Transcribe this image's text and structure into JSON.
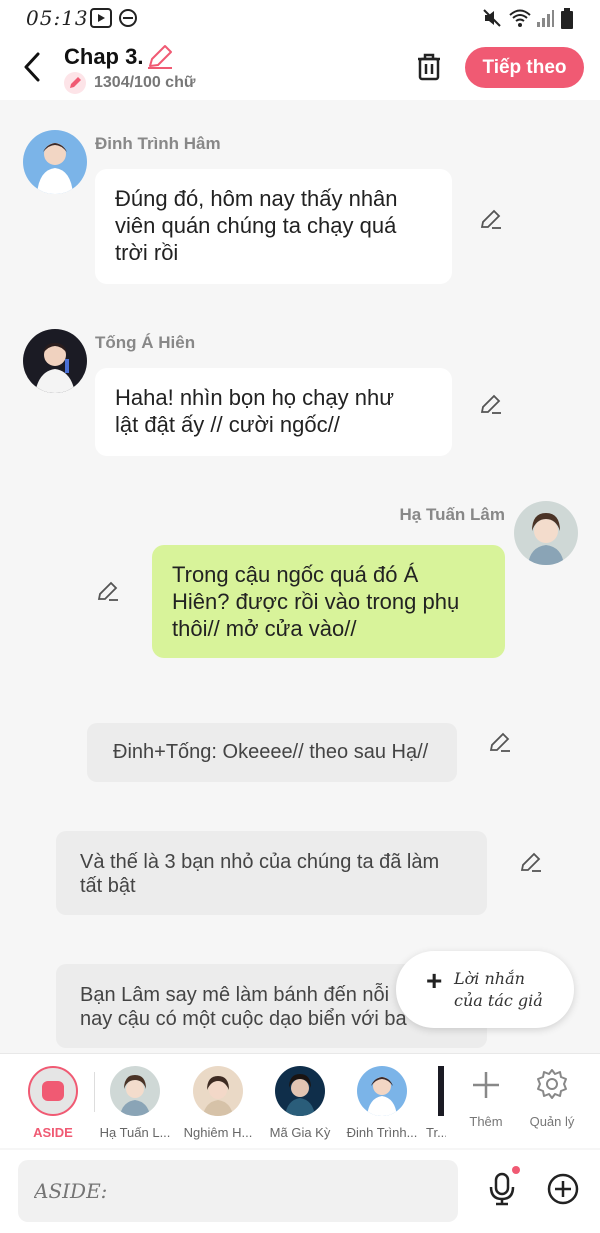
{
  "status_bar": {
    "time": "05:13"
  },
  "header": {
    "title": "Chap 3.",
    "word_count": "1304/100 chữ",
    "next_button": "Tiếp theo"
  },
  "messages": [
    {
      "speaker": "Đinh Trình Hâm",
      "text_lines": [
        "Đúng đó, hôm nay thấy nhân",
        "viên quán chúng ta chạy quá",
        "trời rồi"
      ]
    },
    {
      "speaker": "Tống Á Hiên",
      "text_lines": [
        "Haha! nhìn bọn họ chạy như",
        "lật đật ấy // cười ngốc//"
      ]
    },
    {
      "speaker": "Hạ Tuấn Lâm",
      "text_lines": [
        "Trong cậu ngốc quá đó Á",
        "Hiên? được rồi vào trong phụ",
        "thôi// mở cửa vào//"
      ]
    }
  ],
  "asides": [
    {
      "text": "Đinh+Tống: Okeeee// theo sau Hạ//"
    },
    {
      "text_lines": [
        "Và thế là 3 bạn nhỏ của chúng ta đã làm",
        "tất bật"
      ]
    },
    {
      "text_lines": [
        "Bạn Lâm say mê làm bánh đến nỗi",
        "nay cậu có một cuộc dạo biển với ba"
      ]
    }
  ],
  "author_note_button": {
    "line1": "Lời nhắn",
    "line2": "của tác giả"
  },
  "character_bar": {
    "aside_label": "ASIDE",
    "characters": [
      "Hạ Tuấn L...",
      "Nghiêm H...",
      "Mã Gia Kỳ",
      "Đinh Trình...",
      "Tr..."
    ],
    "add_label": "Thêm",
    "manage_label": "Quản lý"
  },
  "input": {
    "placeholder": "ASIDE:"
  },
  "colors": {
    "accent": "#f05a73",
    "green_bubble": "#d8f39a",
    "aside_bg": "#ececec"
  }
}
